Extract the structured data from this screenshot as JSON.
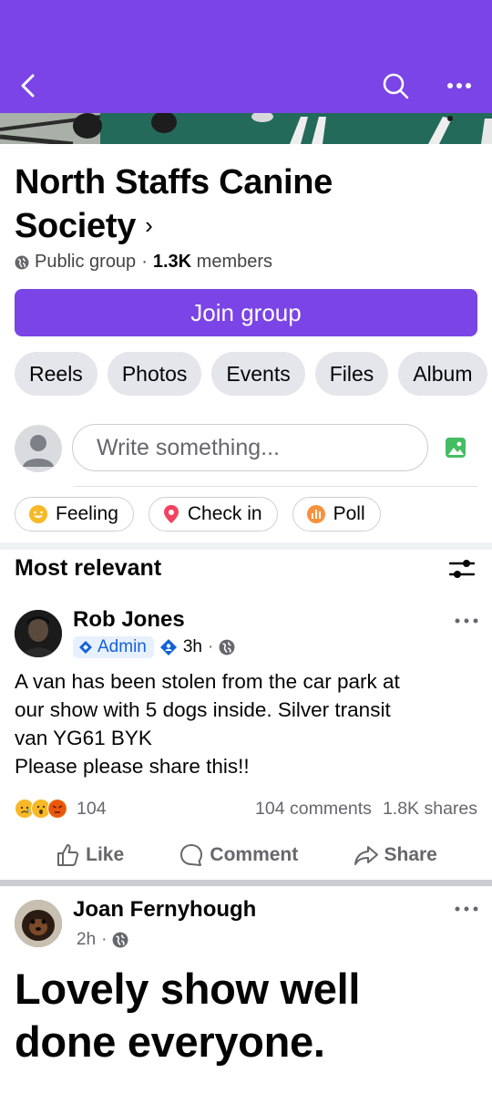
{
  "header": {
    "back_icon": "back-chevron-icon",
    "search_icon": "search-icon",
    "more_icon": "more-dots-icon",
    "color": "#7b44e6"
  },
  "group": {
    "name": "North Staffs Canine Society",
    "chevron": "›",
    "privacy": "Public group",
    "separator": "·",
    "member_count": "1.3K",
    "members_label": "members",
    "join_label": "Join group"
  },
  "tabs": [
    {
      "label": "Reels"
    },
    {
      "label": "Photos"
    },
    {
      "label": "Events"
    },
    {
      "label": "Files"
    },
    {
      "label": "Album"
    }
  ],
  "composer": {
    "placeholder": "Write something...",
    "chips": [
      {
        "label": "Feeling",
        "icon": "smiley-icon"
      },
      {
        "label": "Check in",
        "icon": "location-pin-icon"
      },
      {
        "label": "Poll",
        "icon": "poll-icon"
      }
    ]
  },
  "feed": {
    "sort_label": "Most relevant",
    "posts": [
      {
        "author": "Rob Jones",
        "badge": "Admin",
        "time": "3h",
        "dot": "·",
        "text_lines": [
          "A van has been  stolen from the car park at",
          "our show with 5 dogs inside. Silver transit",
          "van YG61 BYK",
          "Please please share this!!"
        ],
        "reaction_count": "104",
        "comments": "104 comments",
        "shares": "1.8K shares"
      },
      {
        "author": "Joan Fernyhough",
        "time": "2h",
        "dot": "·",
        "text_lines": [
          "Lovely show well",
          "done everyone."
        ]
      }
    ],
    "actions": {
      "like": "Like",
      "comment": "Comment",
      "share": "Share"
    }
  }
}
